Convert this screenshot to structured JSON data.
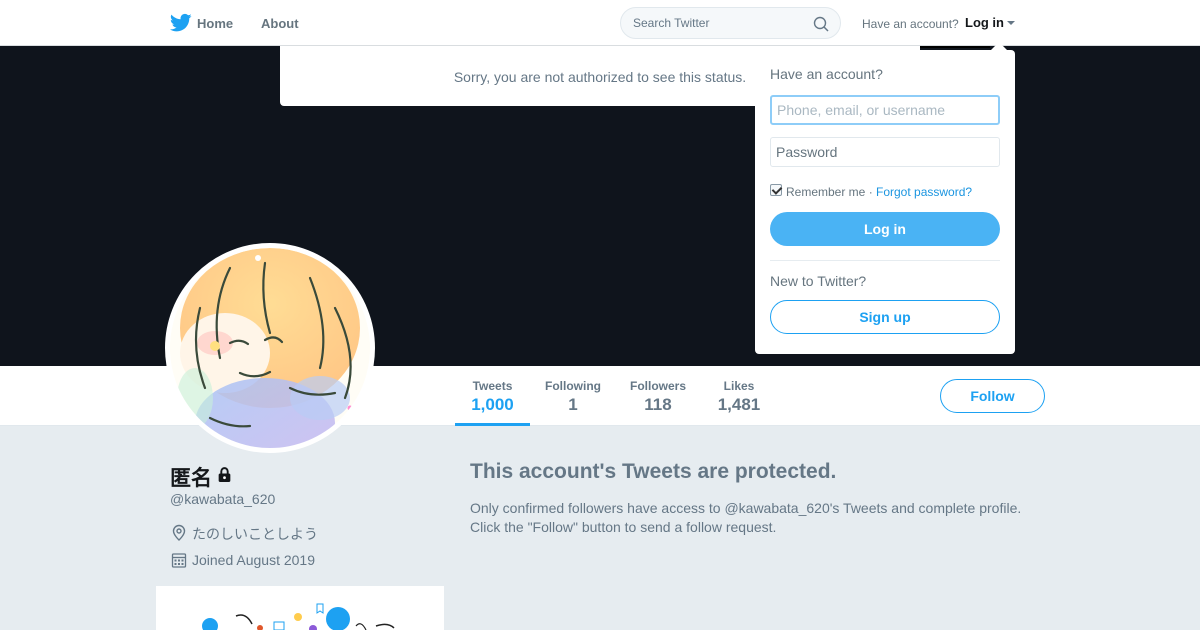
{
  "nav": {
    "home": "Home",
    "about": "About",
    "search_placeholder": "Search Twitter",
    "have_account": "Have an account?",
    "login": "Log in"
  },
  "alert": {
    "text": "Sorry, you are not authorized to see this status."
  },
  "profile": {
    "name": "匿名",
    "handle": "@kawabata_620",
    "location": "たのしいことしよう",
    "joined": "Joined August 2019"
  },
  "stats": [
    {
      "label": "Tweets",
      "value": "1,000",
      "active": true
    },
    {
      "label": "Following",
      "value": "1"
    },
    {
      "label": "Followers",
      "value": "118"
    },
    {
      "label": "Likes",
      "value": "1,481"
    }
  ],
  "follow_button": "Follow",
  "protected": {
    "title": "This account's Tweets are protected.",
    "line1": "Only confirmed followers have access to @kawabata_620's Tweets and complete profile.",
    "line2": "Click the \"Follow\" button to send a follow request."
  },
  "login_dropdown": {
    "title": "Have an account?",
    "username_placeholder": "Phone, email, or username",
    "password_placeholder": "Password",
    "remember": "Remember me ·",
    "forgot": "Forgot password?",
    "login_button": "Log in",
    "new_to": "New to Twitter?",
    "signup_button": "Sign up",
    "remember_checked": true
  },
  "colors": {
    "accent": "#1da1f2",
    "banner": "#0f141c",
    "background": "#e6ecf0"
  }
}
